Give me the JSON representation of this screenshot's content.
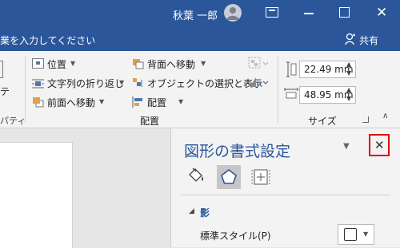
{
  "titlebar": {
    "user_name": "秋葉 一郎",
    "bg": "#2b579a"
  },
  "tellme": {
    "text": "業を入力してください",
    "share_label": "共有"
  },
  "ribbon": {
    "left_partial_text": "テ",
    "left_partial_label": "パティ",
    "arrange": {
      "position_label": "位置",
      "wrap_text_label": "文字列の折り返し",
      "bring_forward_label": "前面へ移動",
      "send_backward_label": "背面へ移動",
      "selection_pane_label": "オブジェクトの選択と表示",
      "align_label": "配置",
      "group_label": "配置"
    },
    "size": {
      "height_value": "22.49 mm",
      "width_value": "48.95 mm",
      "group_label": "サイズ"
    }
  },
  "pane": {
    "title": "図形の書式設定",
    "close_glyph": "✕",
    "highlight_color": "#e0000d",
    "section_label": "影",
    "preset_label": "標準スタイル(P)",
    "preset_mnemonic": "P"
  }
}
